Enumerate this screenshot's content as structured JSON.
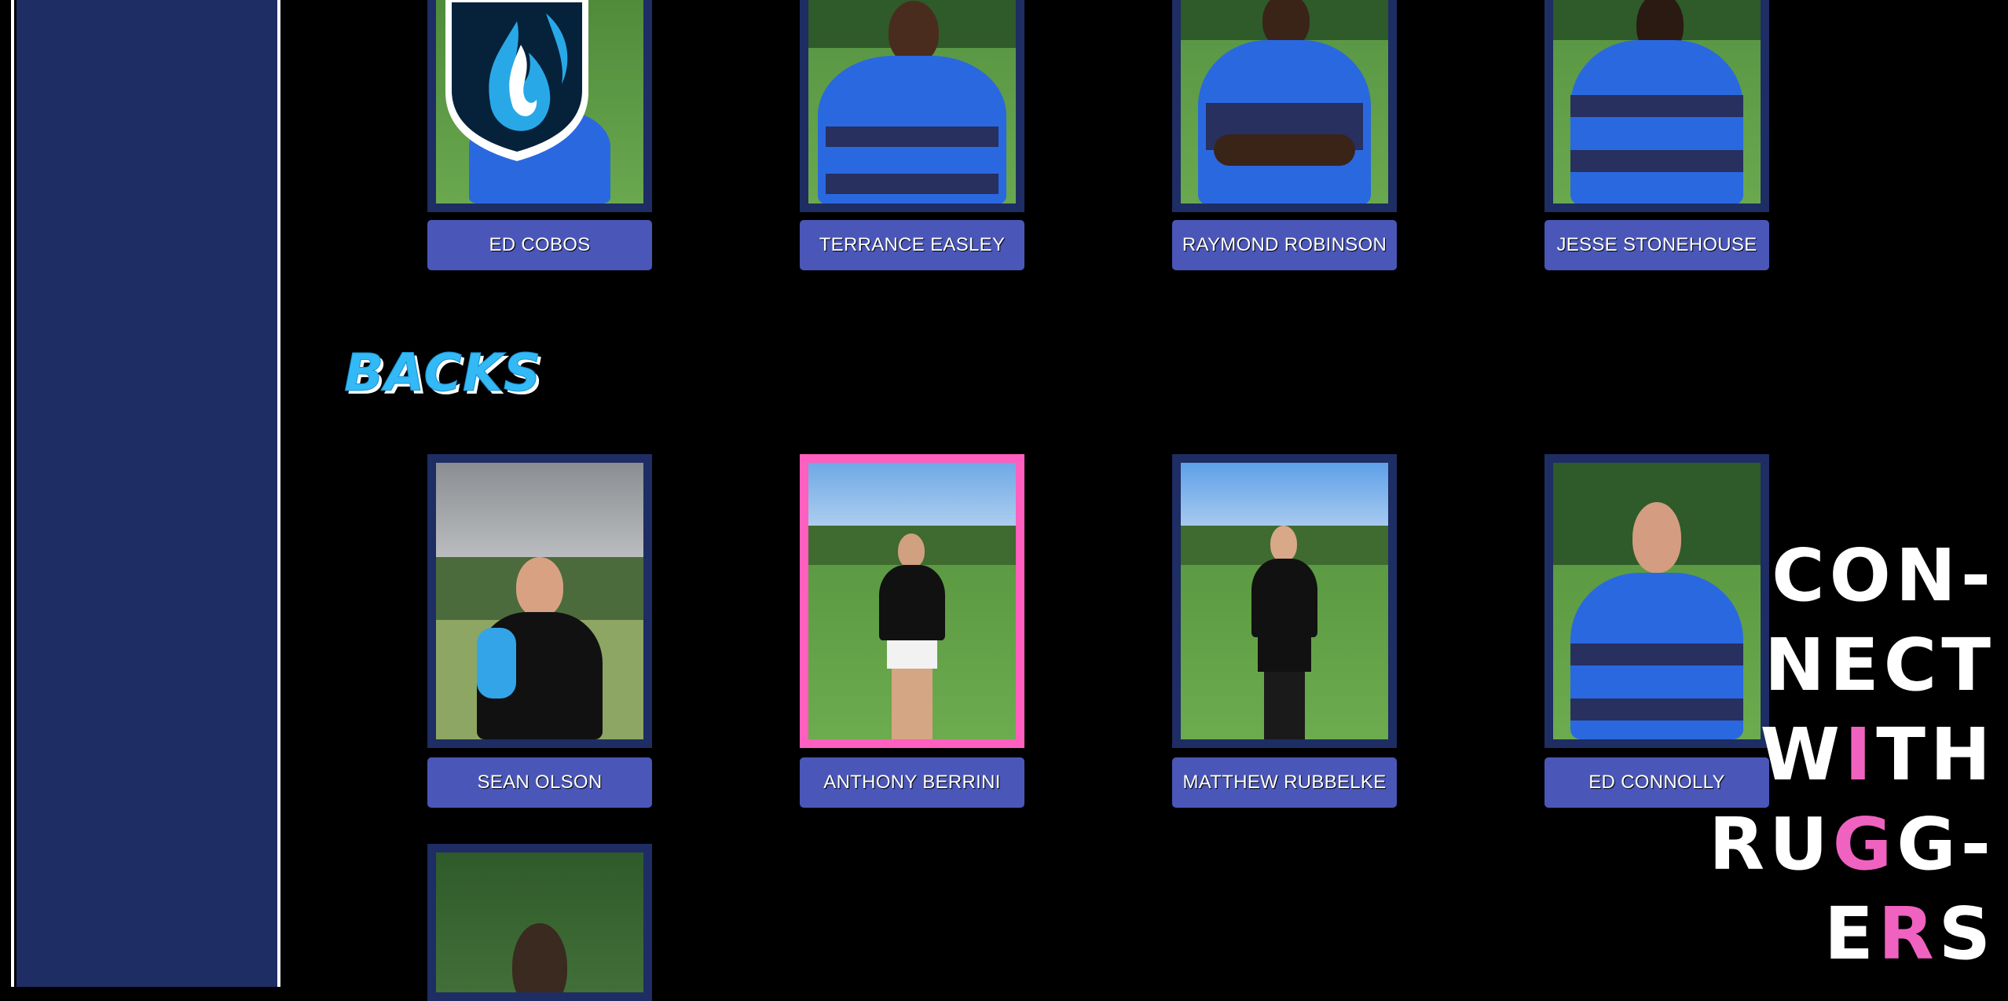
{
  "sections": {
    "backs_title": "BACKS"
  },
  "forwards": [
    {
      "name": "ED COBOS",
      "jersey": "#1e3f9c",
      "has_crest": true
    },
    {
      "name": "TERRANCE EASLEY",
      "jersey": "#2a68e0"
    },
    {
      "name": "RAYMOND ROBINSON",
      "jersey": "#2a68e0"
    },
    {
      "name": "JESSE STONEHOUSE",
      "jersey": "#2a68e0"
    }
  ],
  "backs": [
    {
      "name": "SEAN OLSON",
      "jersey": "#111111",
      "selected": false
    },
    {
      "name": "ANTHONY BERRINI",
      "jersey": "#111111",
      "selected": true
    },
    {
      "name": "MATTHEW RUBBELKE",
      "jersey": "#111111",
      "selected": false
    },
    {
      "name": "ED CONNOLLY",
      "jersey": "#2a68e0",
      "selected": false
    }
  ],
  "connect_banner": {
    "line1": "CON-",
    "line2": "NECT",
    "line3_a": "W",
    "line3_b": "I",
    "line3_c": "TH",
    "line4_a": "RU",
    "line4_b": "G",
    "line4_c": "G-",
    "line5_a": "E",
    "line5_b": "R",
    "line5_c": "S"
  },
  "colors": {
    "sidebar": "#1e2d63",
    "frame": "#1e2d63",
    "selected_frame": "#ff5fbf",
    "name_button": "#4a57b8",
    "title_blue": "#33b9f5",
    "accent_pink": "#f062c0"
  }
}
